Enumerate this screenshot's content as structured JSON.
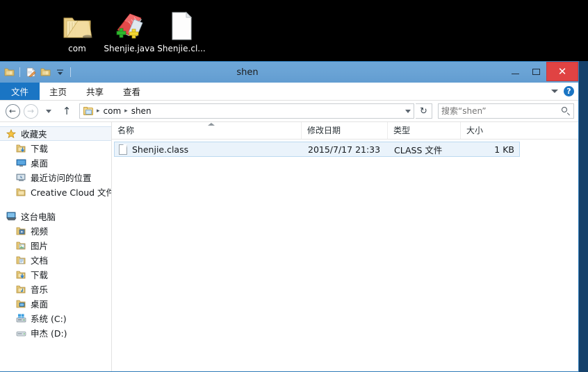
{
  "desktop": {
    "icons": [
      {
        "label": "com",
        "icon": "folder-icon",
        "type": "folder"
      },
      {
        "label": "Shenjie.java",
        "icon": "notepadpp-file-icon",
        "type": "java-file"
      },
      {
        "label": "Shenjie.cl...",
        "icon": "blank-document-icon",
        "type": "class-file"
      }
    ]
  },
  "window": {
    "title": "shen",
    "quick_access": [
      {
        "name": "folder-properties-icon"
      },
      {
        "name": "new-folder-icon"
      },
      {
        "name": "customize-qat-dropdown"
      }
    ],
    "controls": {
      "minimize": "—",
      "maximize": "❐",
      "close": "✕"
    },
    "close_color": "#e04343",
    "titlebar_color": "#6aa3d5"
  },
  "ribbon": {
    "tabs": [
      {
        "label": "文件",
        "active": true
      },
      {
        "label": "主页",
        "active": false
      },
      {
        "label": "共享",
        "active": false
      },
      {
        "label": "查看",
        "active": false
      }
    ],
    "accent": "#1a75c4",
    "help_label": "?"
  },
  "address": {
    "back_label": "‹",
    "forward_label": "›",
    "recent_label": "recent-locations-dropdown",
    "up_label": "↑",
    "refresh_label": "↻",
    "breadcrumb": [
      {
        "label": "com"
      },
      {
        "label": "shen"
      }
    ],
    "separator": "▸"
  },
  "search": {
    "placeholder": "搜索“shen”",
    "value": ""
  },
  "sidebar": {
    "groups": [
      {
        "name": "收藏夹",
        "icon": "star-icon",
        "highlight": true,
        "items": [
          {
            "label": "下载",
            "icon": "downloads-folder-icon"
          },
          {
            "label": "桌面",
            "icon": "desktop-icon"
          },
          {
            "label": "最近访问的位置",
            "icon": "recent-places-icon"
          },
          {
            "label": "Creative Cloud 文件",
            "icon": "folder-icon"
          }
        ]
      },
      {
        "name": "这台电脑",
        "icon": "this-pc-icon",
        "highlight": false,
        "items": [
          {
            "label": "视频",
            "icon": "videos-folder-icon"
          },
          {
            "label": "图片",
            "icon": "pictures-folder-icon"
          },
          {
            "label": "文档",
            "icon": "documents-folder-icon"
          },
          {
            "label": "下载",
            "icon": "downloads-folder-icon"
          },
          {
            "label": "音乐",
            "icon": "music-folder-icon"
          },
          {
            "label": "桌面",
            "icon": "desktop-folder-icon"
          },
          {
            "label": "系统 (C:)",
            "icon": "system-drive-icon"
          },
          {
            "label": "申杰 (D:)",
            "icon": "drive-icon"
          }
        ]
      }
    ]
  },
  "filelist": {
    "columns": [
      {
        "label": "名称",
        "sorted": "asc"
      },
      {
        "label": "修改日期",
        "sorted": ""
      },
      {
        "label": "类型",
        "sorted": ""
      },
      {
        "label": "大小",
        "sorted": ""
      }
    ],
    "rows": [
      {
        "name": "Shenjie.class",
        "date": "2015/7/17 21:33",
        "type": "CLASS 文件",
        "size": "1 KB",
        "icon": "blank-document-icon",
        "selected": true
      }
    ],
    "selection_color": "#eaf3fb"
  }
}
